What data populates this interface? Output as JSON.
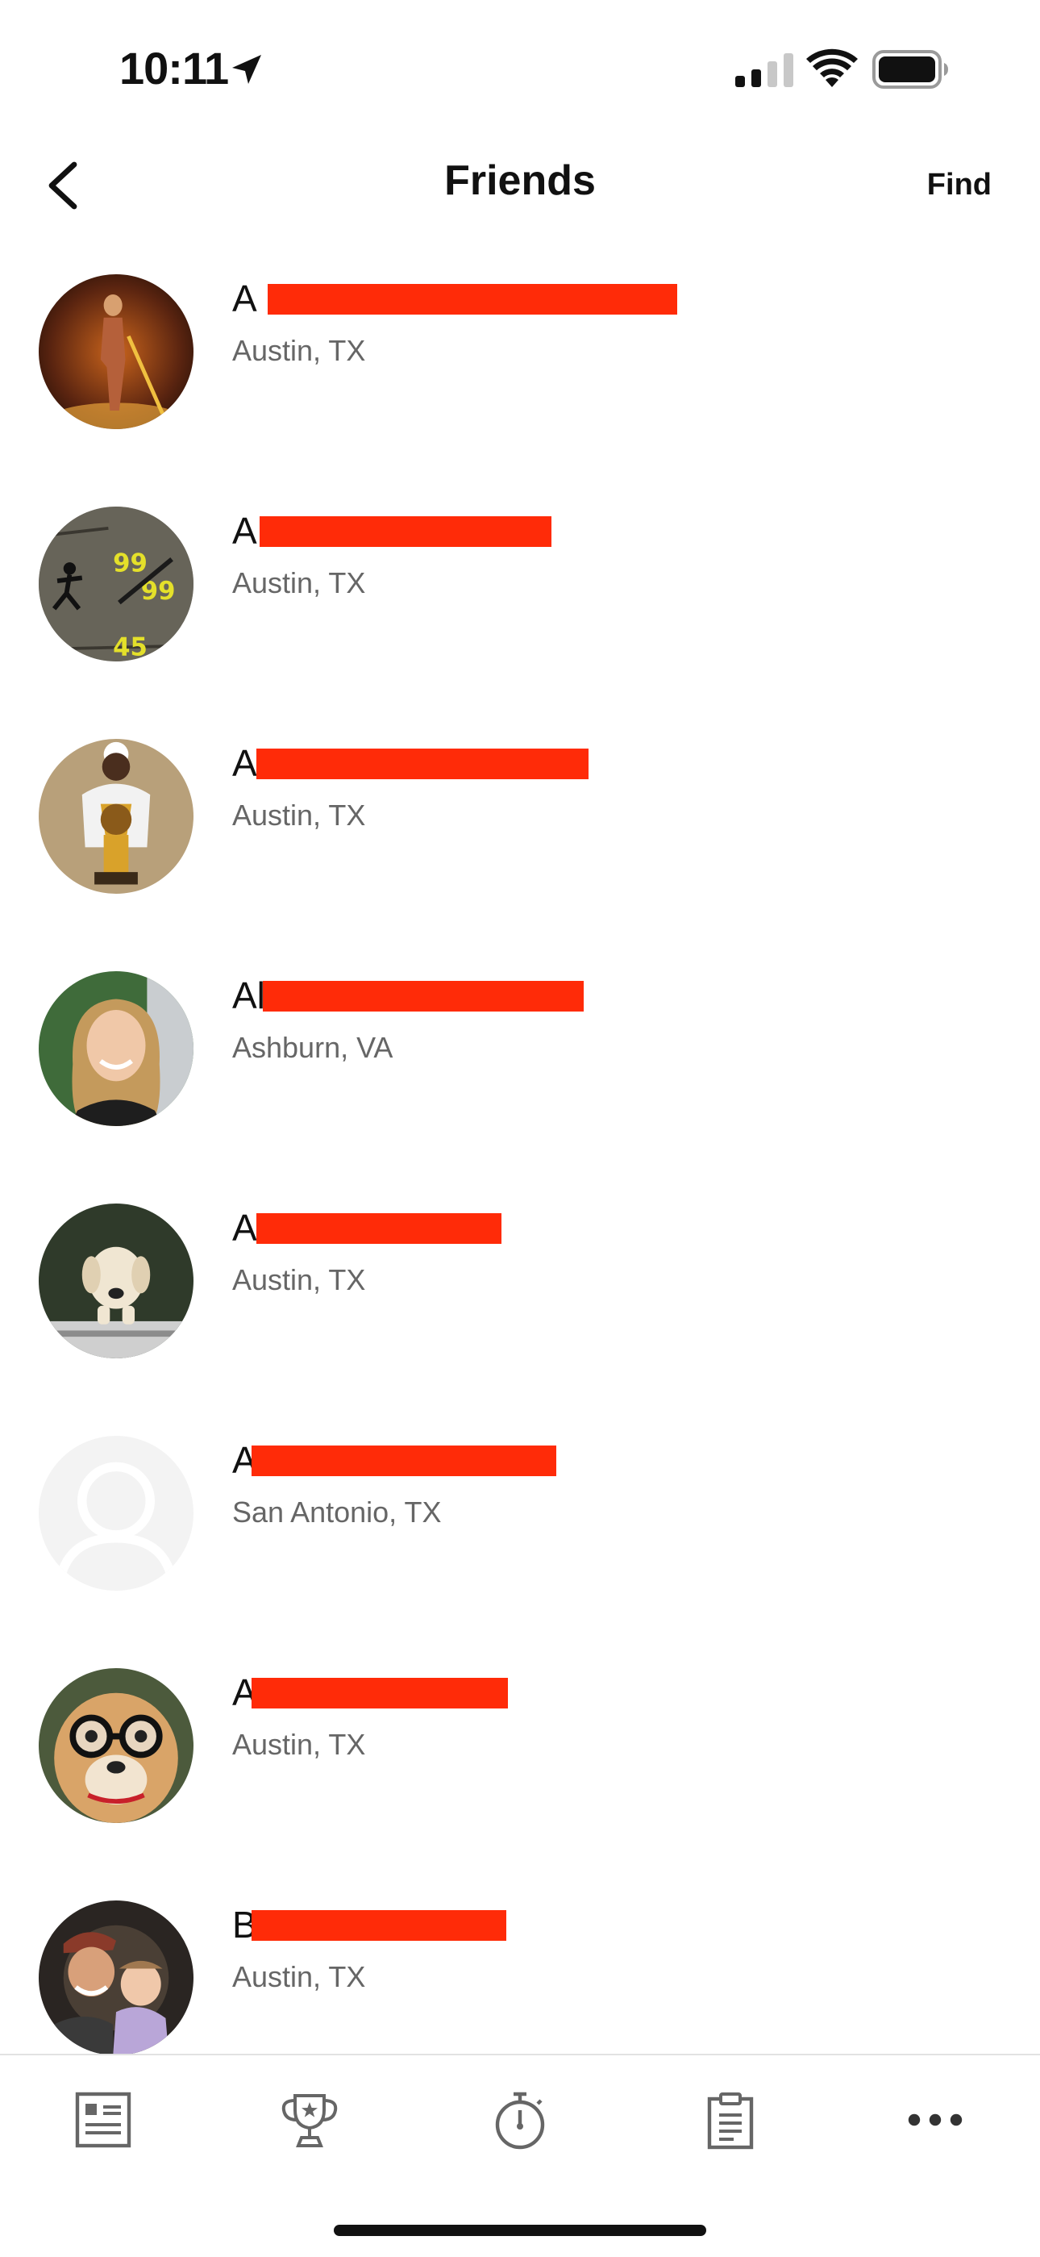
{
  "status_bar": {
    "time": "10:11"
  },
  "nav": {
    "title": "Friends",
    "find_label": "Find"
  },
  "colors": {
    "redaction": "#ff2b08",
    "secondary_text": "#666666"
  },
  "friends": [
    {
      "name_visible": "A",
      "location": "Austin, TX",
      "avatar": "fire-figure-avatar"
    },
    {
      "name_visible": "A",
      "location": "Austin, TX",
      "avatar": "game-stats-avatar"
    },
    {
      "name_visible": "A",
      "location": "Austin, TX",
      "avatar": "trophy-person-avatar"
    },
    {
      "name_visible": "Al",
      "location": "Ashburn, VA",
      "avatar": "woman-portrait-avatar"
    },
    {
      "name_visible": "A",
      "location": "Austin, TX",
      "avatar": "dog-avatar"
    },
    {
      "name_visible": "A",
      "location": "San Antonio, TX",
      "avatar": "default-person-avatar"
    },
    {
      "name_visible": "A",
      "location": "Austin, TX",
      "avatar": "dog-glasses-avatar"
    },
    {
      "name_visible": "B",
      "location": "Austin, TX",
      "avatar": "family-avatar"
    }
  ],
  "tab_bar": {
    "tabs": [
      {
        "icon": "feed-icon"
      },
      {
        "icon": "trophy-icon"
      },
      {
        "icon": "stopwatch-icon"
      },
      {
        "icon": "clipboard-icon"
      },
      {
        "icon": "more-icon"
      }
    ]
  }
}
